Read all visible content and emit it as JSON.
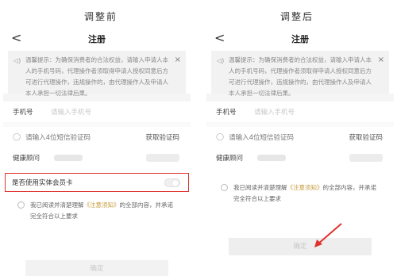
{
  "captions": {
    "before": "调整前",
    "after": "调整后"
  },
  "screen": {
    "title": "注册",
    "back_glyph": "<",
    "close_glyph": "×",
    "notice": "温馨提示：为确保消费者的合法权益，请输入申请人本人的手机号码，代理操作者须取得申请人授权同意后方可进行代理操作，违规操作的，由代理操作人及申请人本人承担一切法律后果。",
    "phone_label": "手机号",
    "phone_placeholder": "请输入手机号",
    "code_placeholder": "请输入4位短信验证码",
    "get_code": "获取验证码",
    "advisor_label_before": "健康顾问",
    "advisor_label_after": "健康顾问",
    "member_card": "是否使用实体会员卡",
    "agree_prefix": "我已阅读并清楚理解",
    "agree_link": "《注意须知》",
    "agree_suffix": "的全部内容，并承诺完全符合以上要求",
    "confirm": "确定"
  },
  "colors": {
    "highlight": "#e0322c",
    "link": "#c79a3a"
  }
}
